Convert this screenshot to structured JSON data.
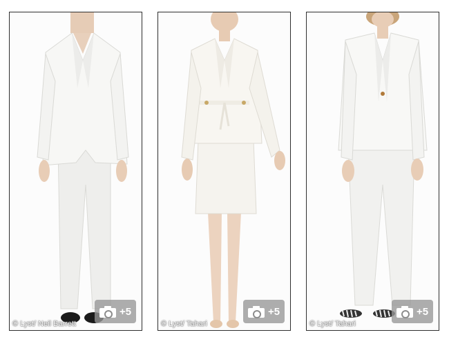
{
  "gallery": [
    {
      "credit": "© Lyst/ Neil Barrett",
      "more_count": "+5",
      "icon": "camera-icon"
    },
    {
      "credit": "© Lyst/ Tahari",
      "more_count": "+5",
      "icon": "camera-icon"
    },
    {
      "credit": "© Lyst/ Tahari",
      "more_count": "+5",
      "icon": "camera-icon"
    }
  ],
  "colors": {
    "border": "#2e2e2e",
    "overlay": "#969696",
    "suit_white": "#f4f4f2",
    "skin": "#e8cdb6"
  }
}
